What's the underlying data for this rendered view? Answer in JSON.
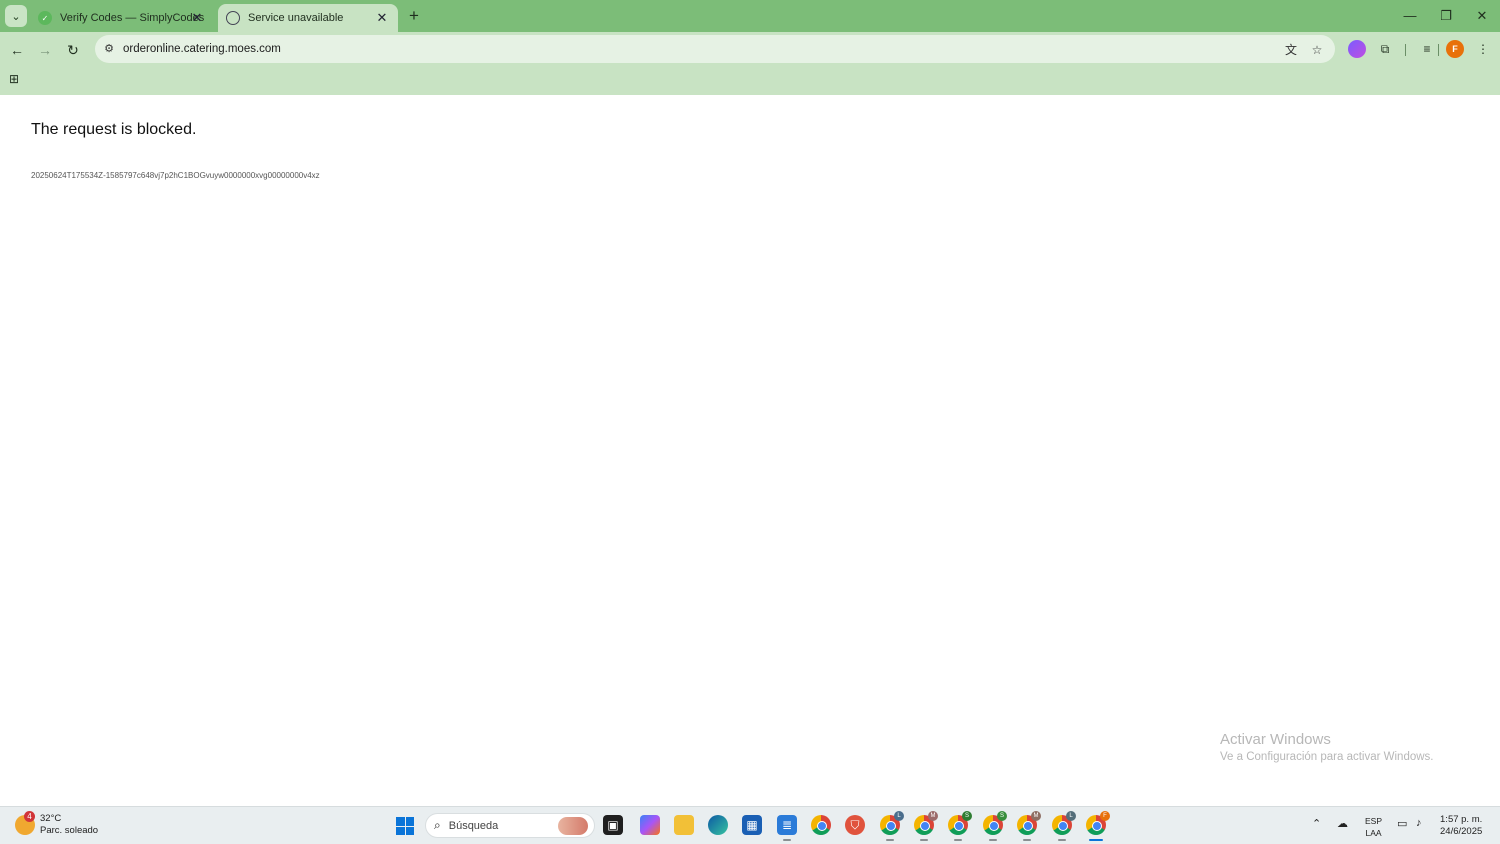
{
  "browser": {
    "tabs": [
      {
        "title": "Verify Codes — SimplyCodes",
        "favicon": "simplycodes-icon",
        "active": false
      },
      {
        "title": "Service unavailable",
        "favicon": "globe-icon",
        "active": true
      }
    ],
    "url": "orderonline.catering.moes.com",
    "profile_initial": "F",
    "accent_color": "#7cbd78"
  },
  "page": {
    "heading": "The request is blocked.",
    "reference_id": "20250624T175534Z-1585797c648vj7p2hC1BOGvuyw0000000xvg00000000v4xz"
  },
  "watermark": {
    "line1": "Activar Windows",
    "line2": "Ve a Configuración para activar Windows."
  },
  "taskbar": {
    "weather": {
      "temp": "32°C",
      "condition": "Parc. soleado",
      "badge": "4"
    },
    "search_placeholder": "Búsqueda",
    "profiles": [
      "L",
      "M",
      "S",
      "S",
      "M",
      "L",
      "F"
    ],
    "language": {
      "lang": "ESP",
      "layout": "LAA"
    },
    "clock": {
      "time": "1:57 p. m.",
      "date": "24/6/2025"
    }
  }
}
